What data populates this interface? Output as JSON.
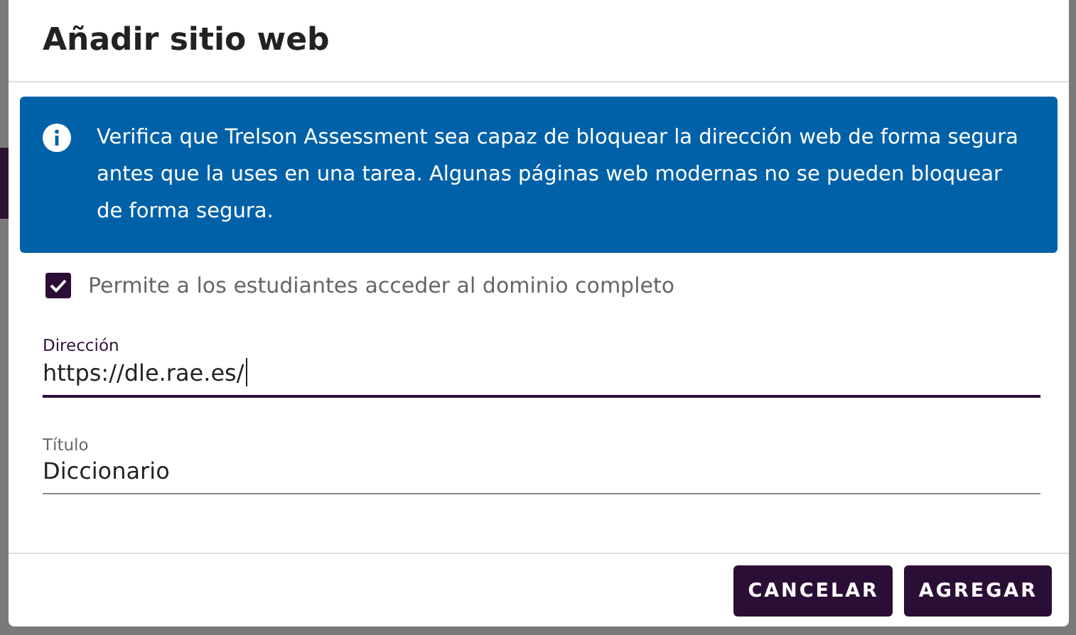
{
  "dialog": {
    "title": "Añadir sitio web"
  },
  "info": {
    "text": "Verifica que Trelson Assessment sea capaz de bloquear la dirección web de forma segura antes que la uses en una tarea. Algunas páginas web modernas no se pueden bloquear de forma segura."
  },
  "checkbox": {
    "label": "Permite a los estudiantes acceder al dominio completo",
    "checked": true
  },
  "fields": [
    {
      "label": "Dirección",
      "value": "https://dle.rae.es/",
      "focused": true
    },
    {
      "label": "Título",
      "value": "Diccionario",
      "focused": false
    }
  ],
  "buttons": [
    "CANCELAR",
    "AGREGAR"
  ]
}
